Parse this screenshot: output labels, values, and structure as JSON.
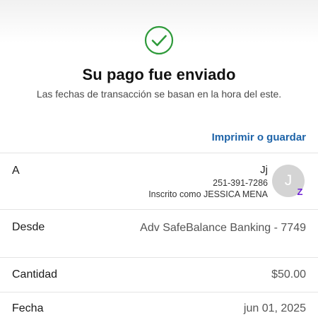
{
  "header": {
    "title": "Su pago fue enviado",
    "subtitle": "Las fechas de transacción se basan en la hora del este.",
    "success_color": "#2e9a3a",
    "icon": "check-circle-icon"
  },
  "actions": {
    "print_label": "Imprimir o guardar",
    "link_color": "#1d63a8"
  },
  "details": {
    "to": {
      "label": "A",
      "name": "Jj",
      "phone": "251-391-7286",
      "enrolled": "Inscrito como JESSICA MENA",
      "avatar_initial": "J",
      "badge": "Z"
    },
    "from": {
      "label": "Desde",
      "value": "Adv SafeBalance Banking - 7749"
    },
    "amount": {
      "label": "Cantidad",
      "value": "$50.00"
    },
    "date": {
      "label": "Fecha",
      "value": "jun 01, 2025"
    }
  }
}
